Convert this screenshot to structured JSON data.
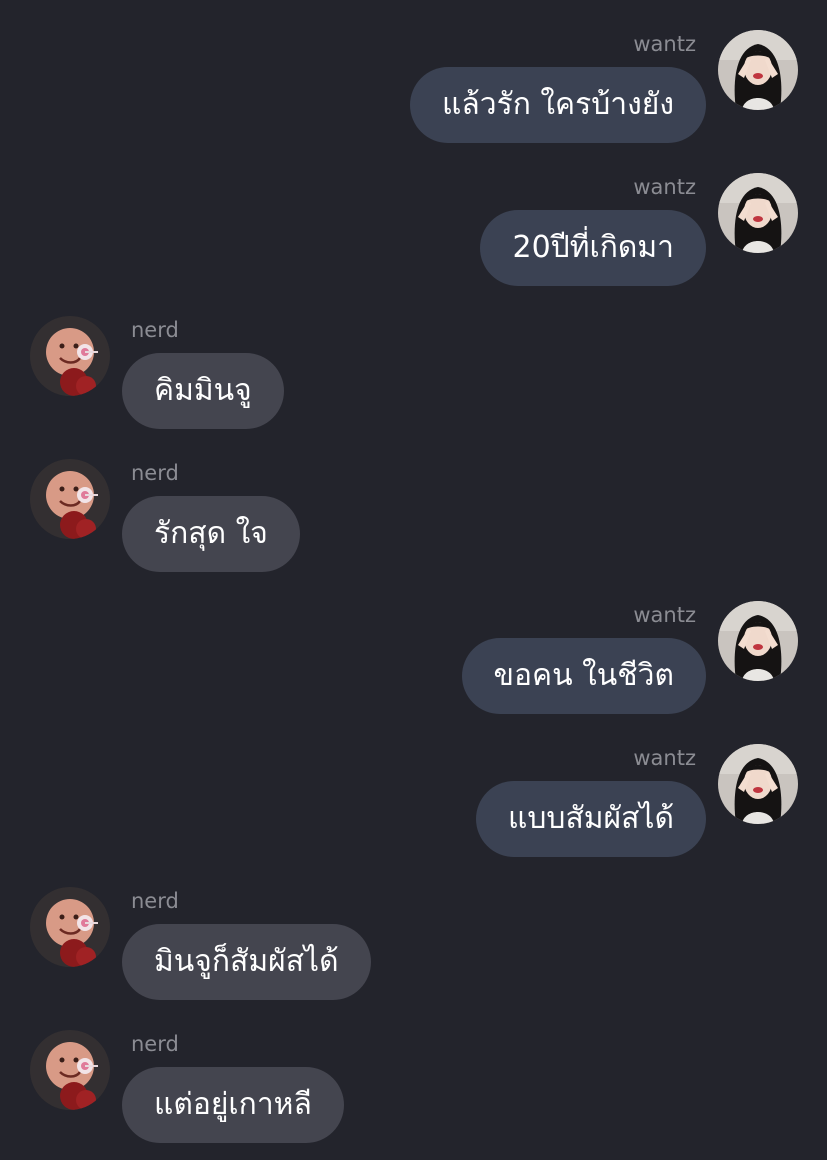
{
  "colors": {
    "background": "#23242c",
    "outgoing_bubble": "#3b4253",
    "incoming_bubble": "#44454f",
    "sender_name": "#8b8c93",
    "message_text": "#ffffff"
  },
  "messages": [
    {
      "direction": "outgoing",
      "sender": "wantz",
      "text": "แล้วรัก ใครบ้างยัง",
      "avatar": "wantz-avatar"
    },
    {
      "direction": "outgoing",
      "sender": "wantz",
      "text": "20ปีที่เกิดมา",
      "avatar": "wantz-avatar"
    },
    {
      "direction": "incoming",
      "sender": "nerd",
      "text": "คิมมินจู",
      "avatar": "nerd-avatar"
    },
    {
      "direction": "incoming",
      "sender": "nerd",
      "text": "รักสุด ใจ",
      "avatar": "nerd-avatar"
    },
    {
      "direction": "outgoing",
      "sender": "wantz",
      "text": "ขอคน ในชีวิต",
      "avatar": "wantz-avatar"
    },
    {
      "direction": "outgoing",
      "sender": "wantz",
      "text": "แบบสัมผัสได้",
      "avatar": "wantz-avatar"
    },
    {
      "direction": "incoming",
      "sender": "nerd",
      "text": "มินจูก็สัมผัสได้",
      "avatar": "nerd-avatar"
    },
    {
      "direction": "incoming",
      "sender": "nerd",
      "text": "แต่อยู่เกาหลี",
      "avatar": "nerd-avatar"
    }
  ]
}
